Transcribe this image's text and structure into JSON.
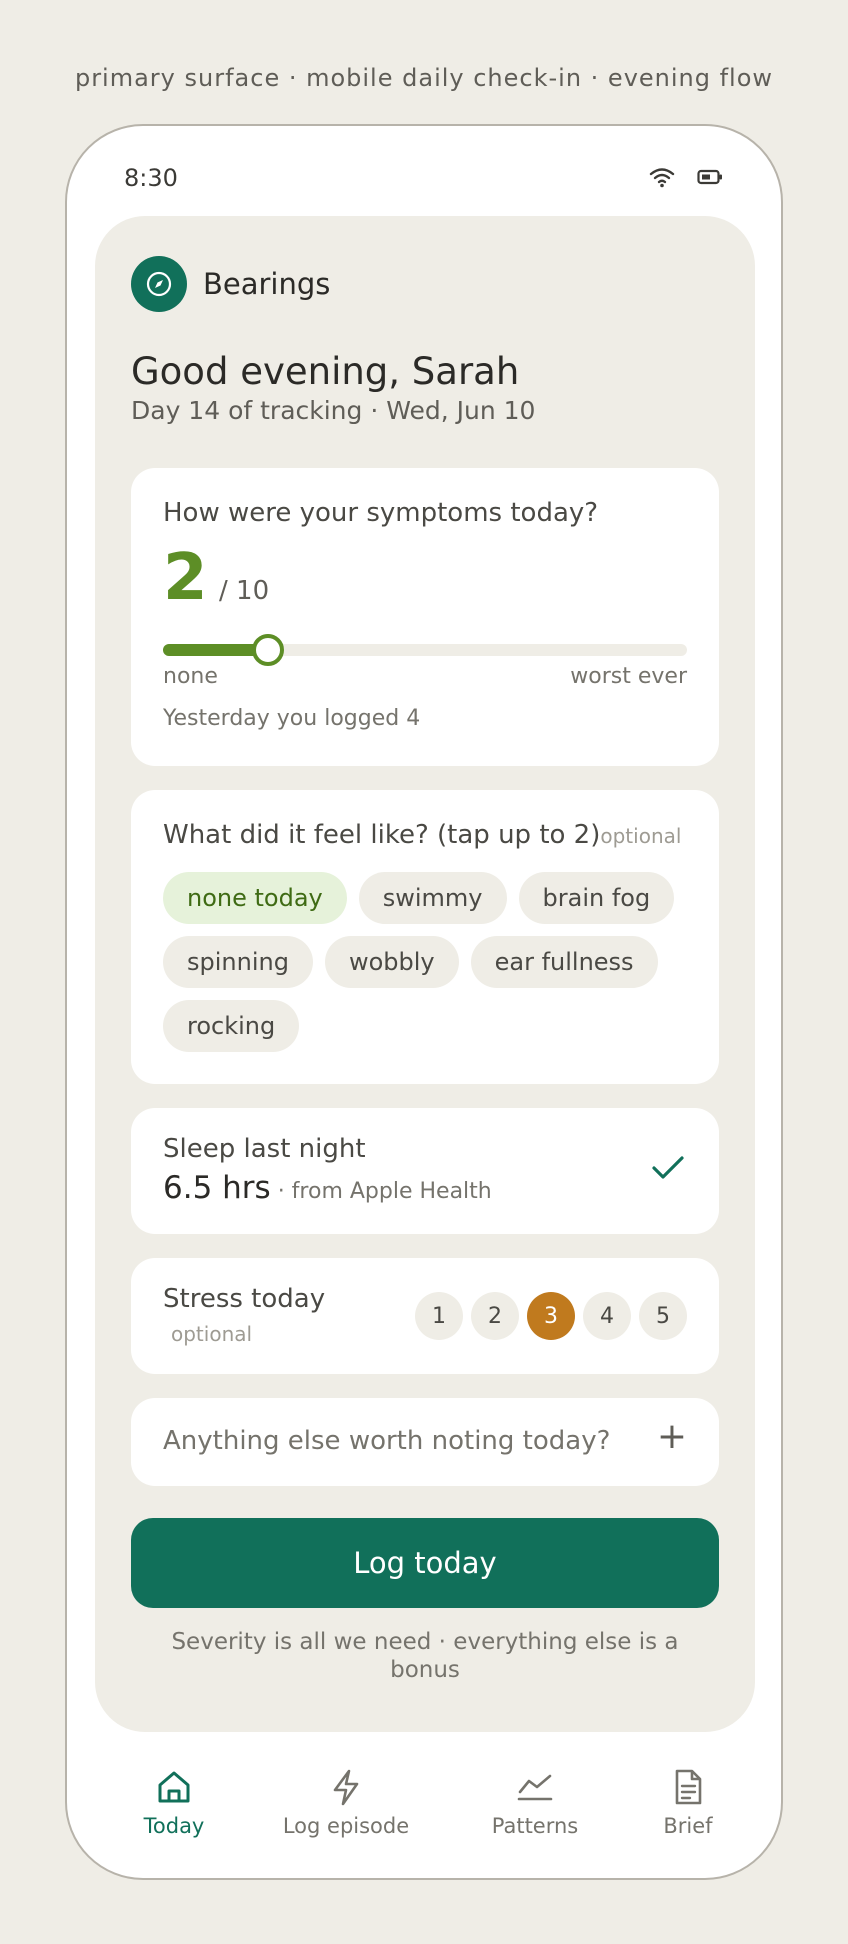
{
  "caption": "primary surface · mobile daily check-in · evening flow",
  "status_bar": {
    "time": "8:30",
    "icons": [
      "wifi-icon",
      "battery-icon"
    ]
  },
  "app": {
    "name": "Bearings",
    "logo_icon": "compass-icon"
  },
  "greeting": "Good evening, Sarah",
  "subtitle": "Day 14 of tracking · Wed, Jun 10",
  "symptoms": {
    "question": "How were your symptoms today?",
    "value": "2",
    "max_label": "/ 10",
    "scale_max": 10,
    "min_label": "none",
    "worst_label": "worst ever",
    "yesterday": "Yesterday you logged 4"
  },
  "feel": {
    "question": "What did it feel like? (tap up to 2)",
    "optional_label": "optional",
    "chips": [
      {
        "label": "none today",
        "selected": true
      },
      {
        "label": "swimmy",
        "selected": false
      },
      {
        "label": "brain fog",
        "selected": false
      },
      {
        "label": "spinning",
        "selected": false
      },
      {
        "label": "wobbly",
        "selected": false
      },
      {
        "label": "ear fullness",
        "selected": false
      },
      {
        "label": "rocking",
        "selected": false
      }
    ]
  },
  "sleep": {
    "title": "Sleep last night",
    "value": "6.5 hrs",
    "source": " · from Apple Health",
    "status_icon": "checkmark-icon"
  },
  "stress": {
    "title": "Stress today",
    "optional_label": "optional",
    "options": [
      "1",
      "2",
      "3",
      "4",
      "5"
    ],
    "selected": "3"
  },
  "note": {
    "placeholder": "Anything else worth noting today?",
    "add_icon": "plus-icon"
  },
  "log_button": "Log today",
  "footnote": "Severity is all we need · everything else is a bonus",
  "tabs": [
    {
      "label": "Today",
      "icon": "home-icon",
      "active": true
    },
    {
      "label": "Log episode",
      "icon": "lightning-icon",
      "active": false
    },
    {
      "label": "Patterns",
      "icon": "trend-chart-icon",
      "active": false
    },
    {
      "label": "Brief",
      "icon": "document-icon",
      "active": false
    }
  ],
  "colors": {
    "brand": "#11705a",
    "severity": "#5d8e26",
    "stress_active": "#c07a1e",
    "background": "#efede6"
  }
}
